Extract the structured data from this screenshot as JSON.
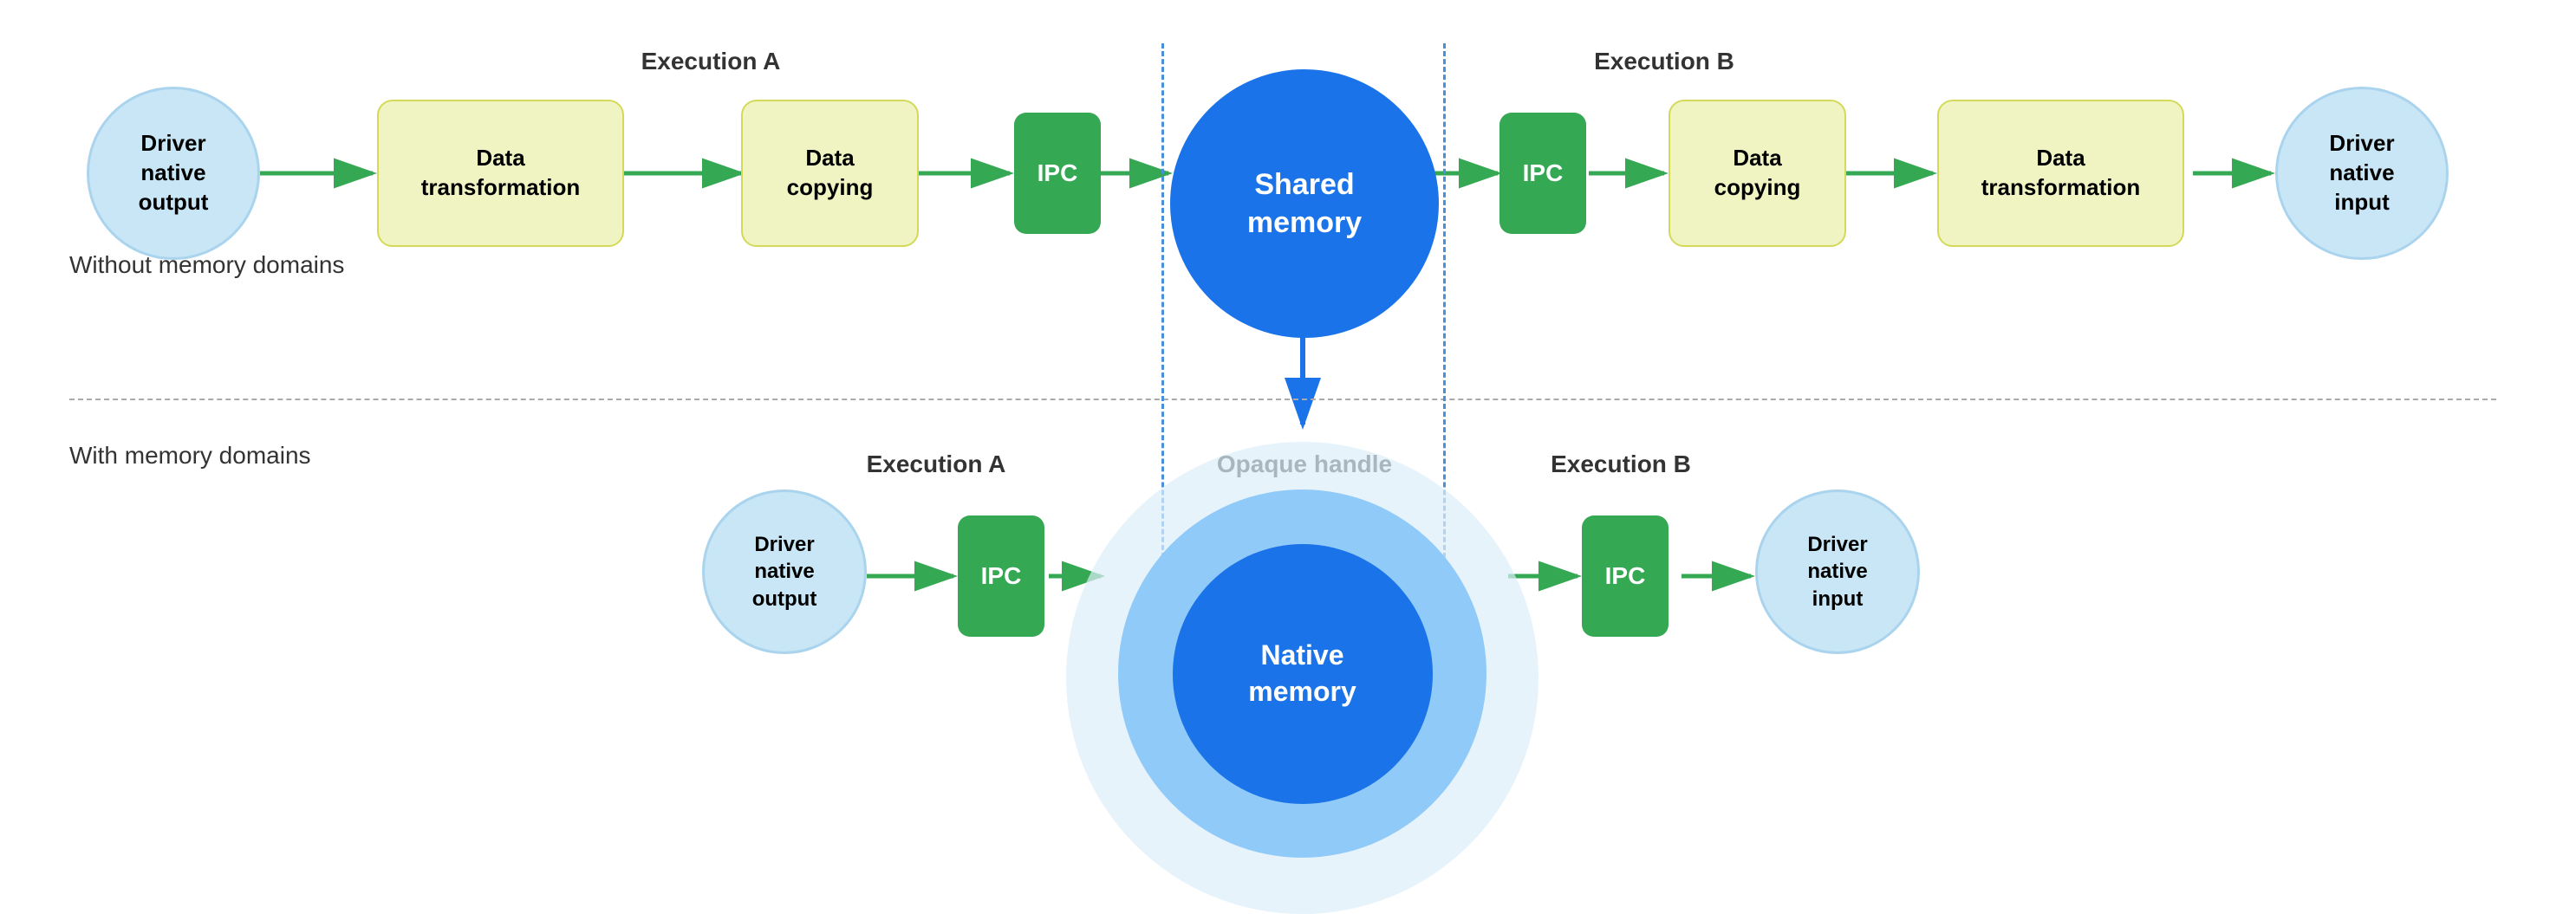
{
  "sections": {
    "without_label": "Without memory domains",
    "with_label": "With memory domains"
  },
  "top_row": {
    "exec_a_label": "Execution A",
    "exec_b_label": "Execution B",
    "nodes": [
      {
        "id": "driver_native_output_top",
        "text": "Driver\nnative\noutput",
        "type": "circle_light"
      },
      {
        "id": "data_transform_left",
        "text": "Data\ntransformation",
        "type": "rect_yellow"
      },
      {
        "id": "data_copying_left",
        "text": "Data\ncopying",
        "type": "rect_yellow"
      },
      {
        "id": "ipc_left",
        "text": "IPC",
        "type": "rect_green"
      },
      {
        "id": "shared_memory",
        "text": "Shared\nmemory",
        "type": "circle_blue"
      },
      {
        "id": "ipc_right",
        "text": "IPC",
        "type": "rect_green"
      },
      {
        "id": "data_copying_right",
        "text": "Data\ncopying",
        "type": "rect_yellow"
      },
      {
        "id": "data_transform_right",
        "text": "Data\ntransformation",
        "type": "rect_yellow"
      },
      {
        "id": "driver_native_input_top",
        "text": "Driver\nnative\ninput",
        "type": "circle_light"
      }
    ]
  },
  "bottom_row": {
    "exec_a_label": "Execution A",
    "exec_b_label": "Execution B",
    "opaque_label": "Opaque handle",
    "nodes": [
      {
        "id": "driver_native_output_bot",
        "text": "Driver\nnative\noutput",
        "type": "circle_light"
      },
      {
        "id": "ipc_bot_left",
        "text": "IPC",
        "type": "rect_green"
      },
      {
        "id": "native_memory_large",
        "text": "Native\nmemory",
        "type": "circle_lightblue_large"
      },
      {
        "id": "ipc_bot_right",
        "text": "IPC",
        "type": "rect_green"
      },
      {
        "id": "driver_native_input_bot",
        "text": "Driver\nnative\ninput",
        "type": "circle_light"
      }
    ]
  },
  "colors": {
    "circle_light_bg": "#c8e6f5",
    "rect_yellow_bg": "#f0f4c3",
    "rect_green_bg": "#34a853",
    "circle_blue_bg": "#1a73e8",
    "circle_lightblue_large_bg": "#b3d9f7",
    "arrow_green": "#34a853",
    "arrow_blue": "#1a73e8",
    "vdotted": "#4a90d9"
  }
}
